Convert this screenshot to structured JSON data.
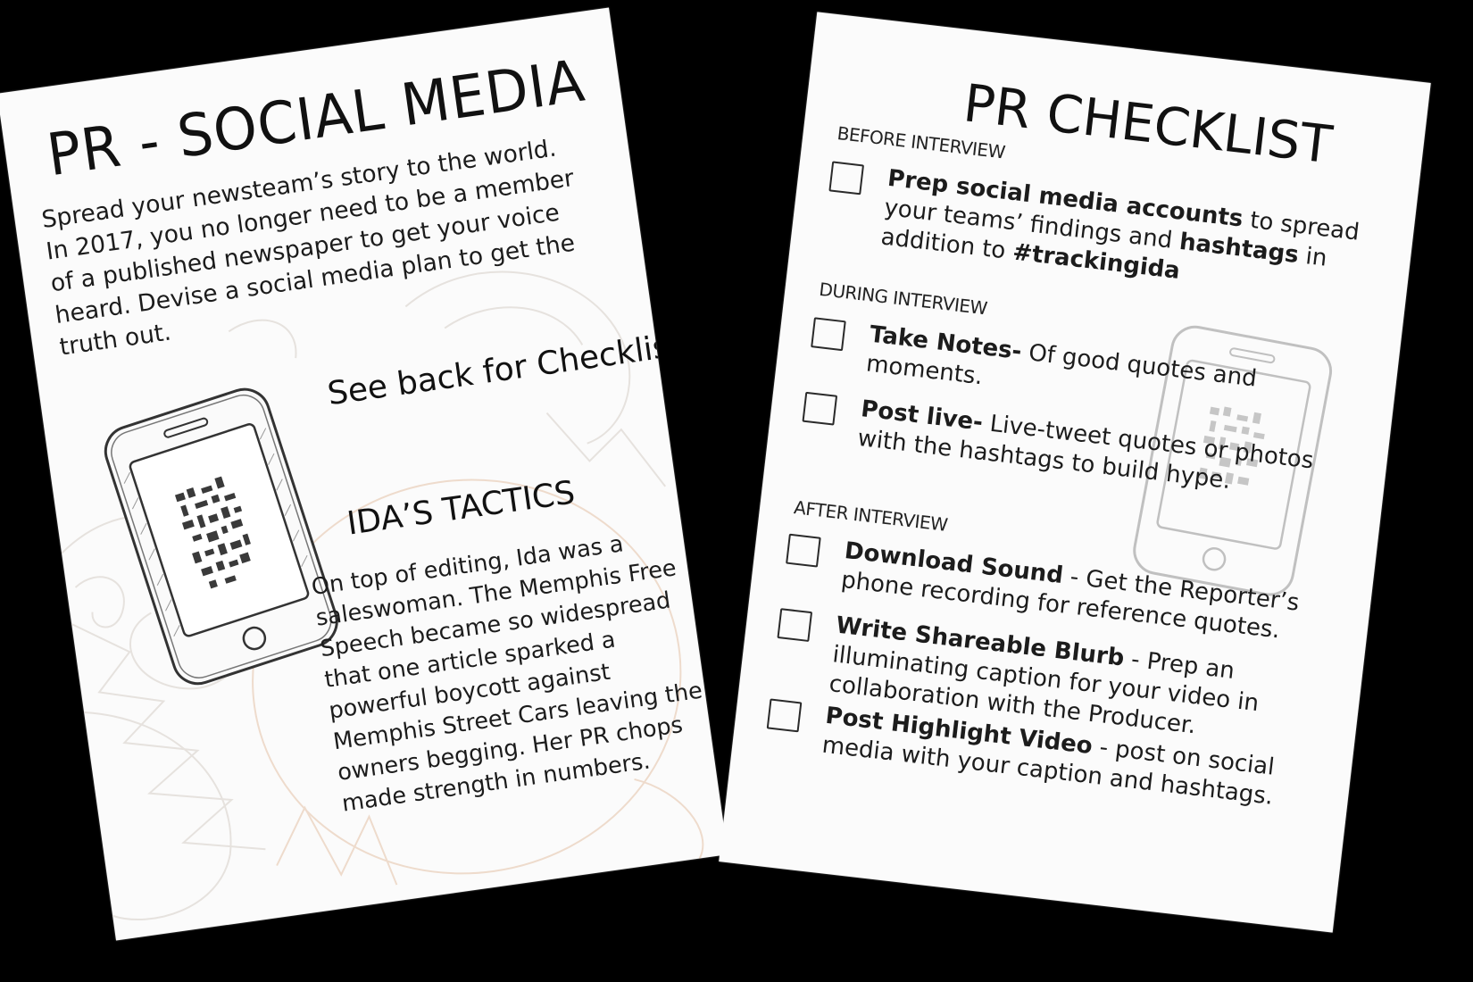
{
  "left_card": {
    "title": "PR - SOCIAL MEDIA",
    "intro": "Spread your newsteam’s story to the world. In 2017, you no longer need to be a member of a published newspaper to get your voice heard. Devise a social media plan to get the truth out.",
    "see_back": "See back for Checklist",
    "tactics_title": "IDA’S TACTICS",
    "tactics_body": "On top of editing, Ida was a saleswoman. The Memphis Free Speech became so widespread that one article sparked a powerful boycott against Memphis Street Cars leaving the owners begging. Her PR chops made strength in numbers.",
    "illustration": "smartphone-qr-icon"
  },
  "right_card": {
    "title": "PR CHECKLIST",
    "sections": [
      {
        "label": "BEFORE INTERVIEW",
        "items": [
          {
            "bold": "Prep social media accounts",
            "text_parts": [
              " to spread your teams’ findings and "
            ],
            "bold2": "hashtags",
            "text2": " in addition to ",
            "bold3": "#trackingida"
          }
        ]
      },
      {
        "label": "DURING INTERVIEW",
        "items": [
          {
            "bold": "Take Notes-",
            "text": " Of good quotes and moments."
          },
          {
            "bold": "Post live-",
            "text": " Live-tweet quotes or photos with the hashtags to build hype."
          }
        ]
      },
      {
        "label": "AFTER INTERVIEW",
        "items": [
          {
            "bold": "Download Sound",
            "text": " - Get the Reporter’s phone recording for reference quotes."
          },
          {
            "bold": "Write Shareable Blurb",
            "text": " - Prep an illuminating caption for your video in collaboration with the Producer."
          },
          {
            "bold": "Post Highlight Video",
            "text": " - post on social media with your caption and hashtags."
          }
        ]
      }
    ],
    "illustration": "smartphone-qr-icon"
  }
}
